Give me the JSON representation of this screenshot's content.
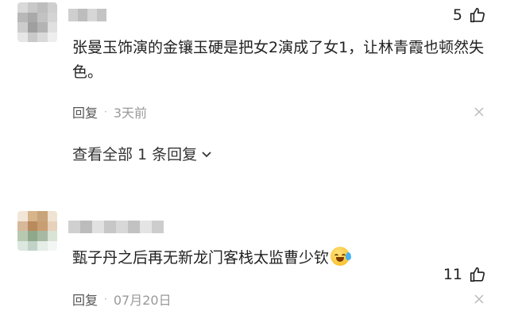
{
  "comments": [
    {
      "likes": "5",
      "text": "张曼玉饰演的金镶玉硬是把女2演成了女1，让林青霞也顿然失色。",
      "reply_label": "回复",
      "time": "3天前",
      "view_replies": "查看全部 1 条回复"
    },
    {
      "likes": "11",
      "text": "甄子丹之后再无新龙门客栈太监曹少钦",
      "emoji": "laughing-crying-emoji",
      "reply_label": "回复",
      "time": "07月20日"
    }
  ],
  "colors": {
    "text": "#222222",
    "meta": "#999999",
    "divider_dot": "#aaaaaa"
  },
  "icons": [
    "thumbs-up-icon",
    "close-icon",
    "chevron-down-icon",
    "laughing-crying-emoji"
  ]
}
